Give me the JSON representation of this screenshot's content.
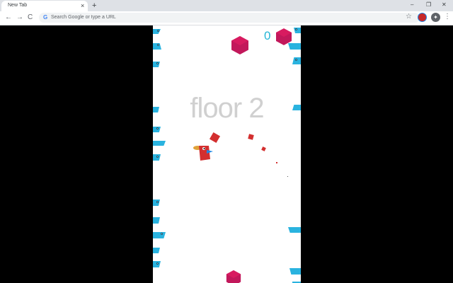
{
  "browser": {
    "tab_title": "New Tab",
    "tab_close": "×",
    "new_tab": "+",
    "window_controls": [
      "–",
      "❐",
      "✕"
    ],
    "nav": [
      "←",
      "→",
      "C"
    ],
    "omnibox_placeholder": "Search Google or type a URL",
    "star": "☆",
    "menu": "⋮"
  },
  "game": {
    "floor_text": "floor 2",
    "score": "0",
    "colors": {
      "spike": "#2ab3df",
      "hex": "#c2185b",
      "cube": "#d32f2f",
      "score": "#26b6d6",
      "floor_text": "#d0d0d0"
    }
  }
}
